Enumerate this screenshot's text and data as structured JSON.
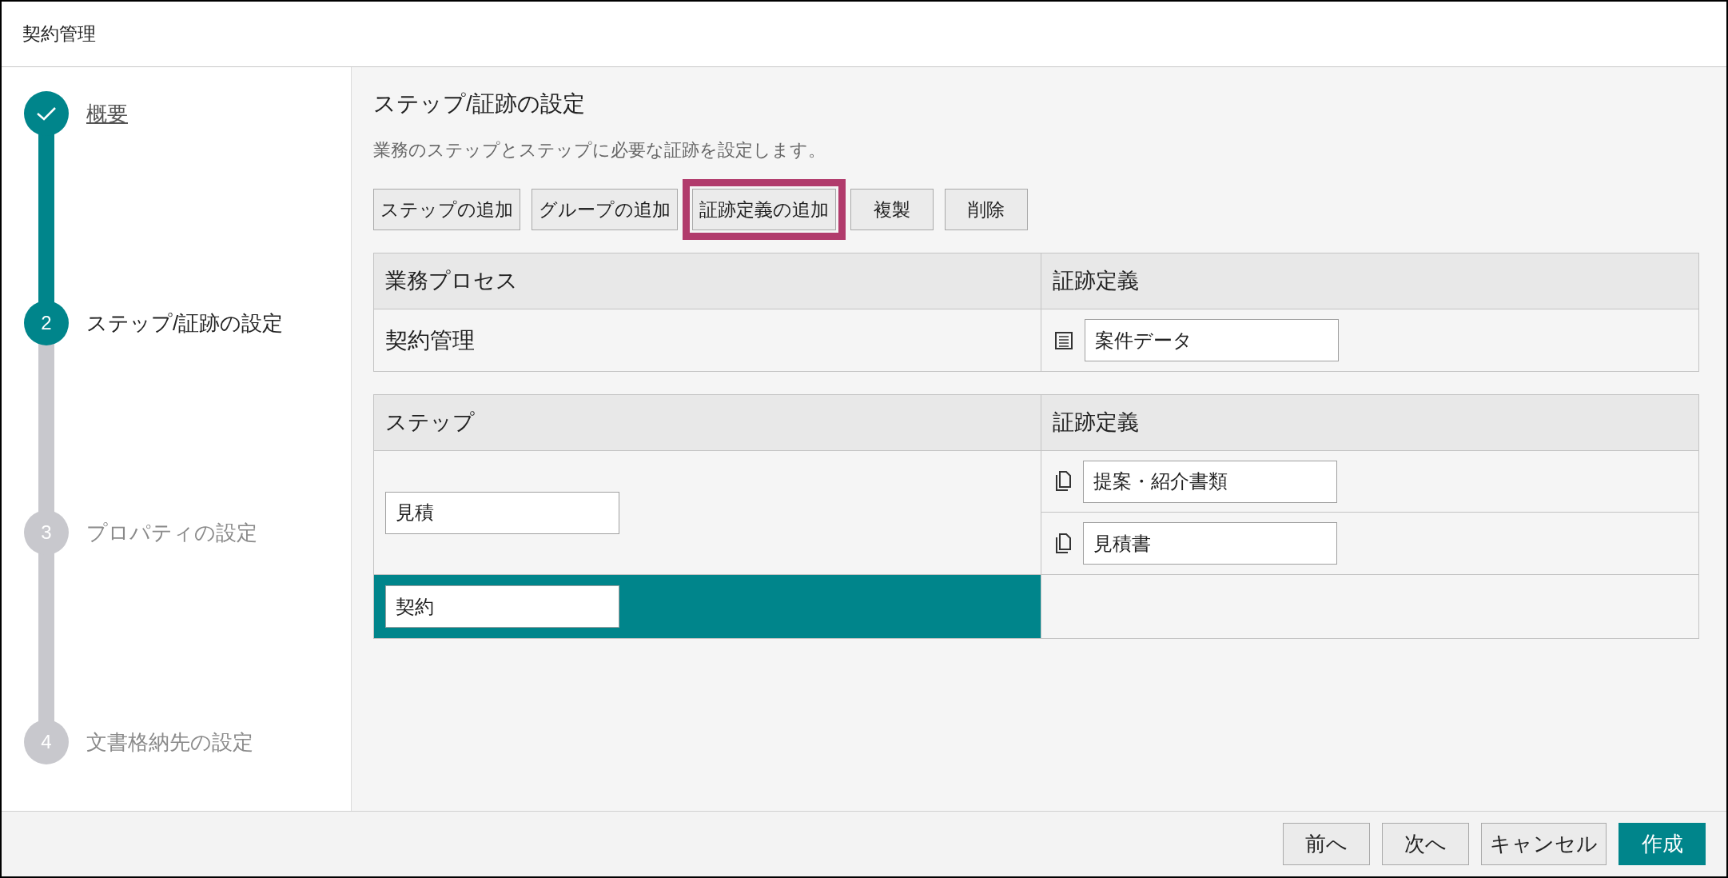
{
  "window": {
    "title": "契約管理"
  },
  "steps": [
    {
      "label": "概要",
      "completed": true,
      "selected": false
    },
    {
      "number": "2",
      "label": "ステップ/証跡の設定",
      "completed": false,
      "selected": true
    },
    {
      "number": "3",
      "label": "プロパティの設定",
      "completed": false,
      "selected": false
    },
    {
      "number": "4",
      "label": "文書格納先の設定",
      "completed": false,
      "selected": false
    }
  ],
  "section": {
    "title": "ステップ/証跡の設定",
    "description": "業務のステップとステップに必要な証跡を設定します。"
  },
  "toolbar": [
    {
      "label": "ステップの追加",
      "highlighted": false
    },
    {
      "label": "グループの追加",
      "highlighted": false
    },
    {
      "label": "証跡定義の追加",
      "highlighted": true
    },
    {
      "label": "複製",
      "highlighted": false
    },
    {
      "label": "削除",
      "highlighted": false
    }
  ],
  "process_table": {
    "columns": [
      "業務プロセス",
      "証跡定義"
    ],
    "rows": [
      {
        "name": "契約管理",
        "evidence": [
          {
            "kind": "data",
            "value": "案件データ"
          }
        ]
      }
    ]
  },
  "step_table": {
    "columns": [
      "ステップ",
      "証跡定義"
    ],
    "rows": [
      {
        "step": "見積",
        "selected": false,
        "evidence": [
          {
            "kind": "document",
            "value": "提案・紹介書類"
          },
          {
            "kind": "document",
            "value": "見積書"
          }
        ]
      },
      {
        "step": "契約",
        "selected": true
      }
    ]
  },
  "footer_buttons": [
    {
      "label": "前へ",
      "primary": false
    },
    {
      "label": "次へ",
      "primary": false
    },
    {
      "label": "キャンセル",
      "primary": false
    },
    {
      "label": "作成",
      "primary": true
    }
  ]
}
